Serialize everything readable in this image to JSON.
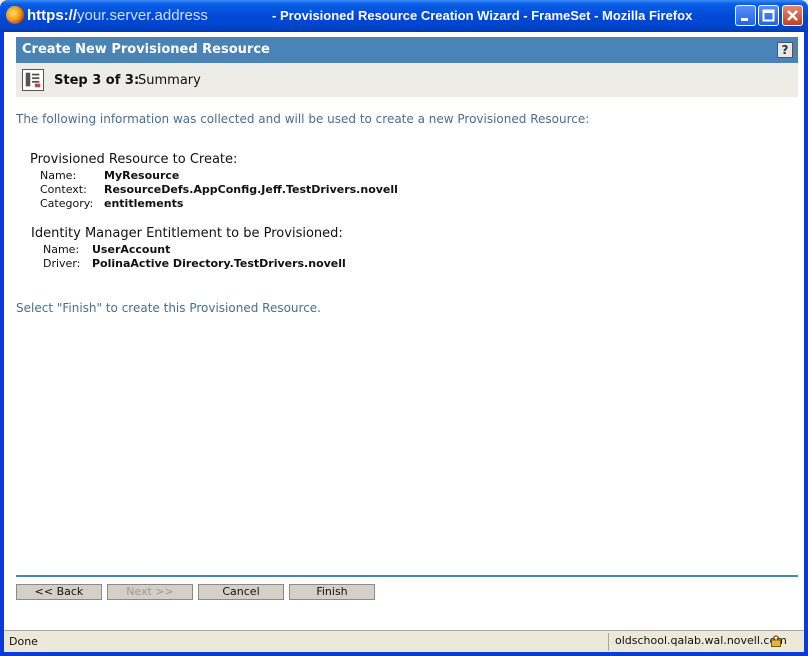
{
  "window": {
    "title_url": "https://",
    "title_host": "your.server.address",
    "title_rest": "- Provisioned Resource Creation Wizard - FrameSet - Mozilla Firefox"
  },
  "header": {
    "title": "Create New Provisioned Resource",
    "help": "?"
  },
  "step": {
    "number": "Step 3 of 3:",
    "name": "Summary"
  },
  "intro": "The following information was collected and will be used to create a new Provisioned Resource:",
  "resource_section": {
    "title": "Provisioned Resource to Create:",
    "rows": [
      {
        "label": "Name:",
        "value": "MyResource"
      },
      {
        "label": "Context:",
        "value": "ResourceDefs.AppConfig.Jeff.TestDrivers.novell"
      },
      {
        "label": "Category:",
        "value": "entitlements"
      }
    ]
  },
  "entitlement_section": {
    "title": "Identity Manager Entitlement to be Provisioned:",
    "rows": [
      {
        "label": "Name:",
        "value": "UserAccount"
      },
      {
        "label": "Driver:",
        "value": "PolinaActive Directory.TestDrivers.novell"
      }
    ]
  },
  "finish_note": "Select \"Finish\" to create this Provisioned Resource.",
  "buttons": {
    "back": "<< Back",
    "next": "Next >>",
    "cancel": "Cancel",
    "finish": "Finish"
  },
  "status": {
    "text": "Done",
    "host": "oldschool.qalab.wal.novell.com"
  },
  "colors": {
    "header_band": "#4a84b6",
    "info_text": "#4a6e8f",
    "titlebar": "#0049d6"
  }
}
